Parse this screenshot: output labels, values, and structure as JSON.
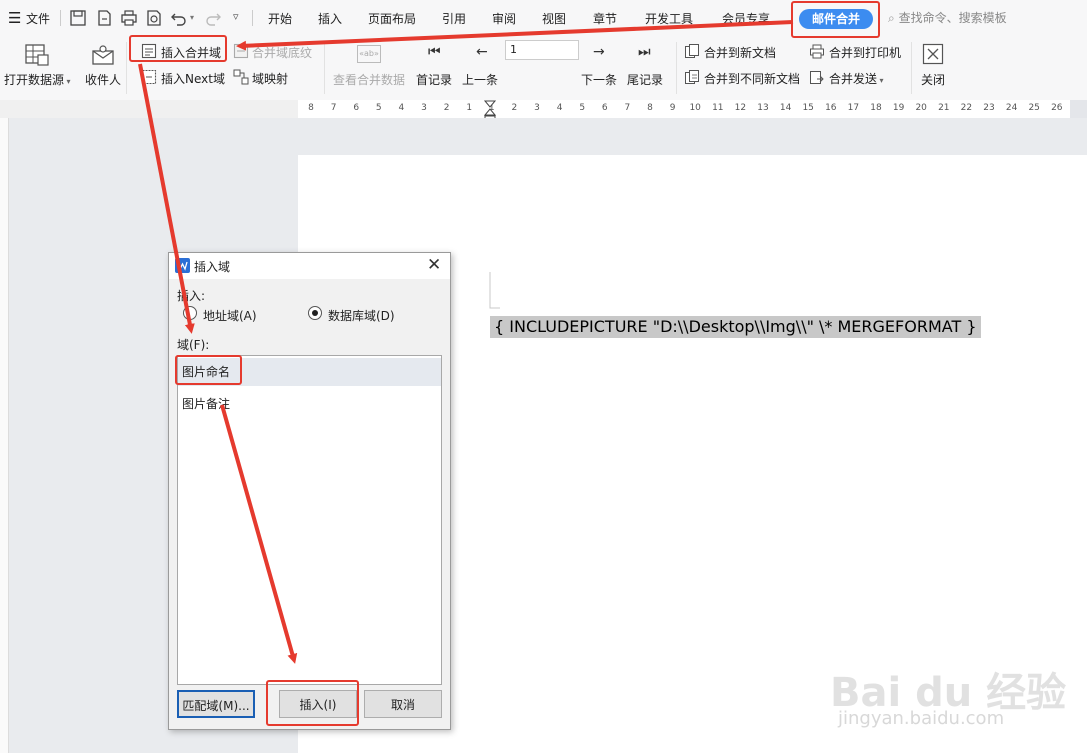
{
  "menubar": {
    "file_label": "文件",
    "tabs": [
      "开始",
      "插入",
      "页面布局",
      "引用",
      "审阅",
      "视图",
      "章节",
      "开发工具",
      "会员专享"
    ],
    "active_tab": "邮件合并",
    "search_placeholder": "查找命令、搜索模板"
  },
  "ribbon": {
    "open_datasource": "打开数据源",
    "recipients": "收件人",
    "insert_merge_field": "插入合并域",
    "merge_field_shading": "合并域底纹",
    "insert_next_field": "插入Next域",
    "field_mapping": "域映射",
    "view_merged_data": "查看合并数据",
    "view_icon_text": "«ab»",
    "first_record": "首记录",
    "prev_record": "上一条",
    "record_number": "1",
    "next_record": "下一条",
    "last_record": "尾记录",
    "merge_new_doc": "合并到新文档",
    "merge_diff_docs": "合并到不同新文档",
    "merge_to_printer": "合并到打印机",
    "merge_send": "合并发送",
    "close": "关闭"
  },
  "ruler": {
    "numbers": [
      "8",
      "7",
      "6",
      "5",
      "4",
      "3",
      "2",
      "1",
      "1",
      "2",
      "3",
      "4",
      "5",
      "6",
      "7",
      "8",
      "9",
      "10",
      "11",
      "12",
      "13",
      "14",
      "15",
      "16",
      "17",
      "18",
      "19",
      "20",
      "21",
      "22",
      "23",
      "24",
      "25",
      "26"
    ]
  },
  "document": {
    "field_code": "{  INCLUDEPICTURE \"D:\\\\Desktop\\\\Img\\\\\" \\* MERGEFORMAT  }"
  },
  "dialog": {
    "title": "插入域",
    "insert_group_label": "插入:",
    "radio_address": "地址域(A)",
    "radio_database": "数据库域(D)",
    "selected_radio": "数据库域(D)",
    "fields_label": "域(F):",
    "fields": [
      "图片命名",
      "图片备注"
    ],
    "selected_field": "图片命名",
    "match_fields_btn": "匹配域(M)...",
    "insert_btn": "插入(I)",
    "cancel_btn": "取消"
  },
  "watermark": {
    "brand": "Bai du 经验",
    "url": "jingyan.baidu.com"
  },
  "colors": {
    "accent": "#3c8cf0",
    "annotation_red": "#e53a2e",
    "field_shading": "#c8c8c8"
  }
}
